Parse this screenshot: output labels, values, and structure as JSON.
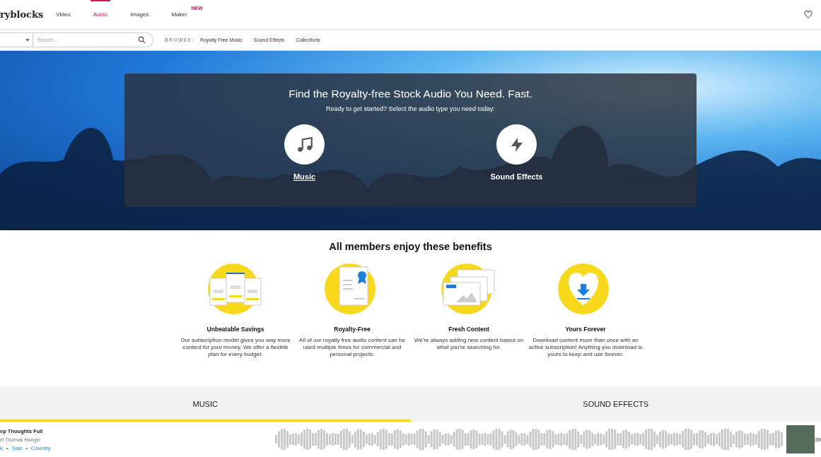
{
  "header": {
    "logo": "ryblocks",
    "nav": [
      {
        "label": "Video",
        "selected": false
      },
      {
        "label": "Audio",
        "selected": true
      },
      {
        "label": "Images",
        "selected": false
      },
      {
        "label": "Maker",
        "selected": false,
        "badge": "NEW"
      }
    ]
  },
  "subnav": {
    "search": {
      "placeholder": "Search..."
    },
    "browse_label": "BROWSE:",
    "links": [
      "Royalty Free Music",
      "Sound Effects",
      "Collections"
    ]
  },
  "hero": {
    "title": "Find the Royalty-free Stock Audio You Need. Fast.",
    "subtitle": "Ready to get started? Select the audio type you need today:",
    "options": [
      {
        "kind": "music",
        "label": "Music",
        "hovered": true
      },
      {
        "kind": "effects",
        "label": "Sound Effects",
        "hovered": false
      }
    ]
  },
  "benefits": {
    "title": "All members enjoy these benefits",
    "items": [
      {
        "kind": "savings",
        "title": "Unbeatable Savings",
        "text": "Our subscription model gives you way more content for your money. We offer a flexible plan for every budget."
      },
      {
        "kind": "royalty",
        "title": "Royalty-Free",
        "text": "All of our royalty free audio content can be used multiple times for commercial and personal projects."
      },
      {
        "kind": "fresh",
        "title": "Fresh Content",
        "text": "We're always adding new content based on what you're searching for."
      },
      {
        "kind": "forever",
        "title": "Yours Forever",
        "text": "Download content more than once with an active subscription! Anything you download is yours to keep and use forever."
      }
    ]
  },
  "tabs": [
    {
      "label": "MUSIC",
      "selected": true
    },
    {
      "label": "SOUND EFFECTS",
      "selected": false
    }
  ],
  "track": {
    "title": "ep Thoughts Full",
    "artist": "el Thomas Hunger",
    "tags": [
      "k",
      "Sad",
      "Country"
    ],
    "separator": "•",
    "duration": "39"
  }
}
